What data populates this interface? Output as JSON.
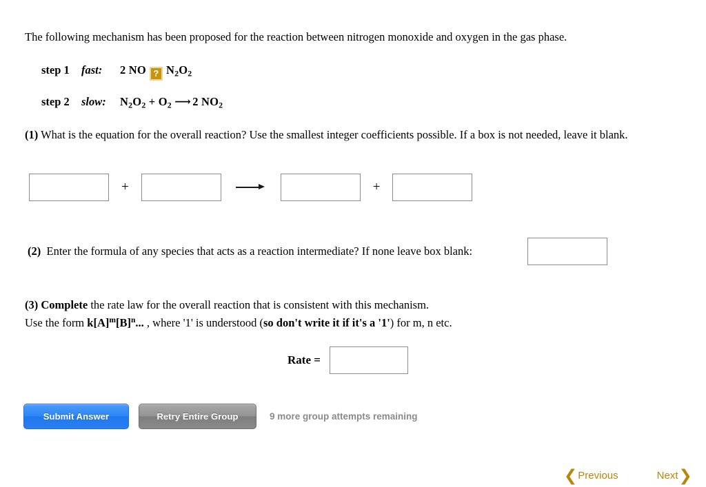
{
  "intro": {
    "text": "The following mechanism has been proposed for the reaction between nitrogen monoxide and oxygen in the gas phase."
  },
  "mechanism": {
    "steps": [
      {
        "label": "step 1",
        "speed": "fast:",
        "reactants": "2 NO",
        "arrow_icon": "broken-image-question-icon",
        "arrow_alt": "?",
        "products_main": "N",
        "products_sub1": "2",
        "products_mid": "O",
        "products_sub2": "2",
        "equation_plain": "2 NO ? N2O2"
      },
      {
        "label": "step 2",
        "speed": "slow:",
        "equation_plain": "N2O2 + O2 ⟶ 2 NO2"
      }
    ]
  },
  "q1": {
    "number": "(1)",
    "text": " What is the equation for the overall reaction? Use the smallest integer coefficients possible. If a box is not needed, leave it blank.",
    "boxes": [
      {
        "name": "reactant-1",
        "value": "",
        "placeholder": ""
      },
      {
        "name": "reactant-2",
        "value": "",
        "placeholder": ""
      },
      {
        "name": "product-1",
        "value": "",
        "placeholder": ""
      },
      {
        "name": "product-2",
        "value": "",
        "placeholder": ""
      }
    ],
    "plus1": "+",
    "plus2": "+"
  },
  "q2": {
    "number": "(2)",
    "text": "Enter the formula of any species that acts as a reaction intermediate? If none leave box blank:",
    "box": {
      "value": "",
      "placeholder": ""
    }
  },
  "q3": {
    "number": "(3)",
    "lead_bold": "Complete",
    "line1_rest": " the rate law for the overall reaction that is consistent with this mechanism.",
    "line2_pre": "Use the form ",
    "formula_k": "k[A]",
    "formula_m": "m",
    "formula_b": "[B]",
    "formula_n": "n",
    "formula_dots": "...",
    "line2_mid": " , where '1' is understood (",
    "line2_bold": "so don't write it if it's a '1'",
    "line2_post": ") for m, n etc.",
    "rate_label": "Rate =",
    "box": {
      "value": "",
      "placeholder": ""
    }
  },
  "actions": {
    "submit_label": "Submit Answer",
    "retry_label": "Retry Entire Group",
    "attempts_text": "9 more group attempts remaining"
  },
  "nav": {
    "prev_label": "Previous",
    "prev_chevron": "❮",
    "next_label": "Next",
    "next_chevron": "❯"
  },
  "colors": {
    "submit_blue": "#2f86f5",
    "retry_gray": "#8a8a8a",
    "attempts_gray": "#8a8a8a",
    "nav_gold": "#b8860b",
    "broken_icon_gold": "#c8940f",
    "box_border": "#8c8c8c"
  }
}
